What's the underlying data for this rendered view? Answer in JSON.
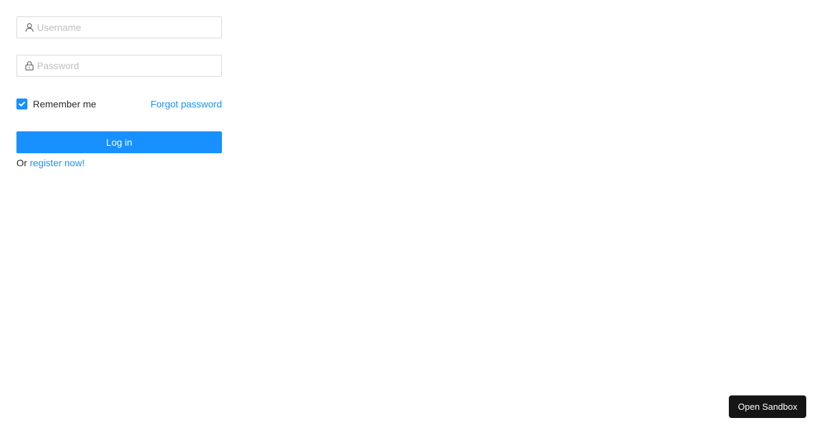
{
  "form": {
    "username": {
      "placeholder": "Username",
      "value": "",
      "icon": "user-icon"
    },
    "password": {
      "placeholder": "Password",
      "value": "",
      "icon": "lock-icon"
    },
    "remember": {
      "label": "Remember me",
      "checked": true
    },
    "forgot_label": "Forgot password",
    "login_label": "Log in",
    "register_prefix": "Or",
    "register_label": "register now!"
  },
  "sandbox": {
    "label": "Open Sandbox"
  },
  "colors": {
    "primary": "#1890ff",
    "sandbox_bg": "#151515",
    "border": "#d9d9d9",
    "placeholder": "#bfbfbf"
  }
}
